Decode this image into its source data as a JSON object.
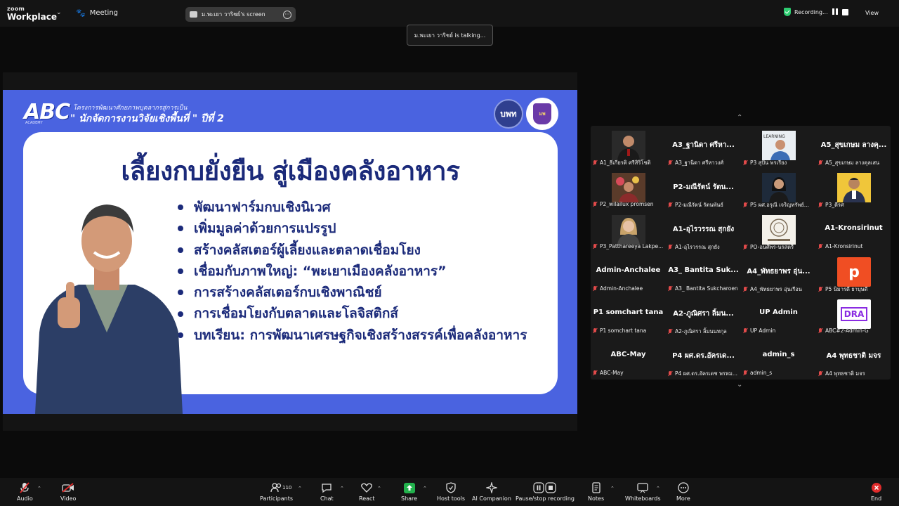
{
  "app": {
    "brand_small": "zoom",
    "brand_big": "Workplace",
    "meeting_label": "Meeting"
  },
  "share_chip": {
    "label": "ม.พะเยา วาริชย์'s screen"
  },
  "status": {
    "recording": "Recording...",
    "view": "View",
    "talking": "ม.พะเยา วาริชย์ is talking..."
  },
  "slide": {
    "logo": "ABC",
    "logo_sub": "ACADEMY",
    "project_line1": "โครงการพัฒนาศักยภาพบุคลากรสู่การเป็น",
    "project_line2": "\" นักจัดการงานวิจัยเชิงพื้นที่ \" ปีที่ 2",
    "badge1": "บพท",
    "badge2": "มพ",
    "headline": "เลี้ยงกบยั่งยืน สู่เมืองคลังอาหาร",
    "bullets": [
      "พัฒนาฟาร์มกบเชิงนิเวศ",
      "เพิ่มมูลค่าด้วยการแปรรูป",
      "สร้างคลัสเตอร์ผู้เลี้ยงและตลาดเชื่อมโยง",
      "เชื่อมกับภาพใหญ่: “พะเยาเมืองคลังอาหาร”",
      "การสร้างคลัสเตอร์กบเชิงพาณิชย์",
      "การเชื่อมโยงกับตลาดและโลจิสติกส์",
      "บทเรียน: การพัฒนาเศรษฐกิจเชิงสร้างสรรค์เพื่อคลังอาหาร"
    ]
  },
  "participants": [
    {
      "big": "",
      "name": "A1_ธีเกียรติ ศรีสิริโชติ",
      "thumb": "photo-man-suit"
    },
    {
      "big": "A3_ฐานิดา ศรีหา...",
      "name": "A3_ฐานิดา ศรีหาวงศ์",
      "thumb": ""
    },
    {
      "big": "",
      "name": "P3 สุปัน พรเรียง",
      "thumb": "photo-learning"
    },
    {
      "big": "A5_สุขเกษม ลางคุ...",
      "name": "A5_สุขเกษม ลางคุลเสน",
      "thumb": ""
    },
    {
      "big": "",
      "name": "P2_wilailux promsen",
      "thumb": "photo-flowers"
    },
    {
      "big": "P2-มณีรัตน์ รัตน...",
      "name": "P2-มณีรัตน์ รัตนพันธ์",
      "thumb": ""
    },
    {
      "big": "",
      "name": "P5 ผศ.อรุณี เจริญทรัพย์...",
      "thumb": "photo-woman"
    },
    {
      "big": "",
      "name": "P3_ตีรศ",
      "thumb": "photo-man-yellow"
    },
    {
      "big": "",
      "name": "P3_Patthareeya Lakpe...",
      "thumb": "photo-woman-blonde"
    },
    {
      "big": "A1-อุไรวรรณ สุกยัง",
      "name": "A1-อุไรวรรณ สุกยัง",
      "thumb": ""
    },
    {
      "big": "",
      "name": "PO-อนศิพร-นรสตรี",
      "thumb": "photo-seal"
    },
    {
      "big": "A1-Kronsirinut",
      "name": "A1-Kronsirinut",
      "thumb": ""
    },
    {
      "big": "Admin-Anchalee",
      "name": "Admin-Anchalee",
      "thumb": ""
    },
    {
      "big": "A3_ Bantita Suk...",
      "name": "A3_ Bantita Sukcharoen",
      "thumb": ""
    },
    {
      "big": "A4_พัทธยาพร อุ่น...",
      "name": "A4_พัทธยาพร อุ่นเรือน",
      "thumb": ""
    },
    {
      "big": "",
      "name": "P5 นิมารดี ยาบุษดี",
      "thumb": "letter-p"
    },
    {
      "big": "P1 somchart tana",
      "name": "P1 somchart tana",
      "thumb": ""
    },
    {
      "big": "A2-ภูณิศรา ลิ้มน...",
      "name": "A2-ภูณิศรา ลิ้มนนทกุล",
      "thumb": ""
    },
    {
      "big": "UP Admin",
      "name": "UP Admin",
      "thumb": ""
    },
    {
      "big": "",
      "name": "ABC#2-Admin-G",
      "thumb": "logo-dra"
    },
    {
      "big": "ABC-May",
      "name": "ABC-May",
      "thumb": ""
    },
    {
      "big": "P4 ผศ.ดร.อัครเด...",
      "name": "P4 ผศ.ดร.อัครเดช พรหม...",
      "thumb": ""
    },
    {
      "big": "admin_s",
      "name": "admin_s",
      "thumb": ""
    },
    {
      "big": "A4 พุทธชาติ มจร",
      "name": "A4 พุทธชาติ มจร",
      "thumb": ""
    }
  ],
  "thumb_text": {
    "letter_p": "p",
    "dra": "DRA"
  },
  "toolbar": {
    "audio": "Audio",
    "video": "Video",
    "participants": "Participants",
    "participants_count": "110",
    "chat": "Chat",
    "react": "React",
    "share": "Share",
    "host_tools": "Host tools",
    "ai": "AI Companion",
    "pause_rec": "Pause/stop recording",
    "notes": "Notes",
    "whiteboards": "Whiteboards",
    "more": "More",
    "end": "End"
  },
  "colors": {
    "slide_bg": "#4a63e0",
    "slide_text": "#1b2a7a",
    "share_green": "#22b14c",
    "end_red": "#e02b2b",
    "muted_red": "#e24a4a"
  }
}
